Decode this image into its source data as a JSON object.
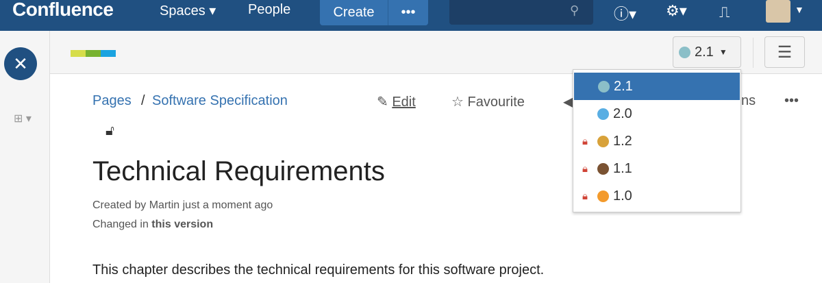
{
  "header": {
    "logo": "Confluence",
    "spaces": "Spaces ▾",
    "people": "People",
    "create": "Create",
    "more": "•••"
  },
  "toolbar": {
    "version_selected": "2.1",
    "version_colors": {
      "2.1": "#8bbfc8",
      "2.0": "#59aee3",
      "1.2": "#d8a23a",
      "1.1": "#7a5232",
      "1.0": "#f39a2c"
    }
  },
  "versions": [
    {
      "label": "2.1",
      "color": "#8bbfc8",
      "locked": false,
      "selected": true
    },
    {
      "label": "2.0",
      "color": "#59aee3",
      "locked": false
    },
    {
      "label": "1.2",
      "color": "#d8a23a",
      "locked": true
    },
    {
      "label": "1.1",
      "color": "#7a5232",
      "locked": true
    },
    {
      "label": "1.0",
      "color": "#f39a2c",
      "locked": true
    }
  ],
  "breadcrumb": {
    "pages": "Pages",
    "sep": "/",
    "space": "Software Specification"
  },
  "actions": {
    "edit": "Edit",
    "favourite": "Favourite",
    "hidden_fragment": "ns",
    "more": "•••"
  },
  "page": {
    "title": "Technical Requirements",
    "created": "Created by Martin just a moment ago",
    "changed_prefix": "Changed in ",
    "changed_bold": "this version",
    "body": "This chapter describes the technical requirements for this software project."
  }
}
